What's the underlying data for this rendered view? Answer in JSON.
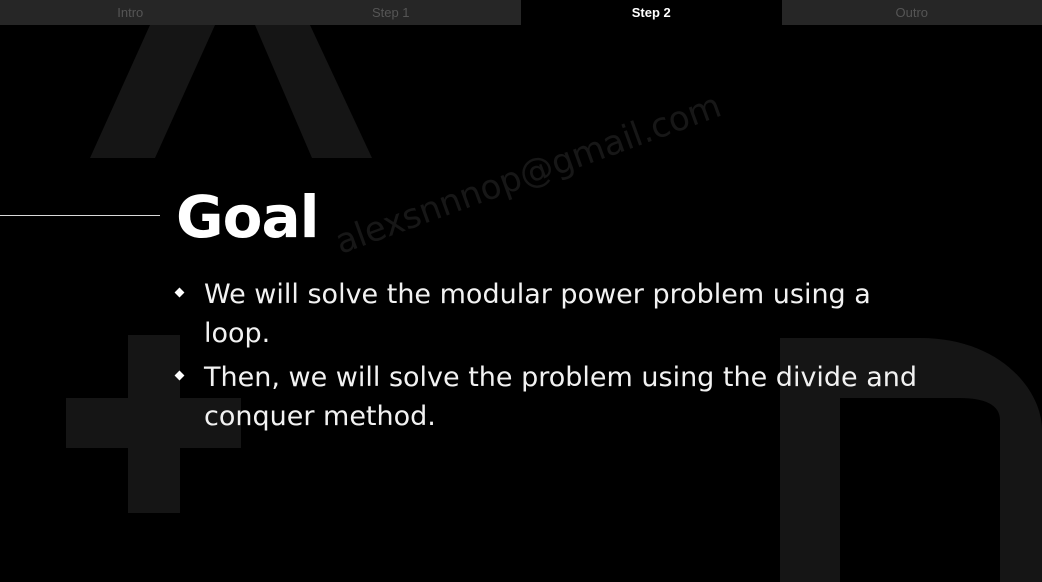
{
  "tabs": [
    {
      "label": "Intro",
      "active": false
    },
    {
      "label": "Step 1",
      "active": false
    },
    {
      "label": "Step 2",
      "active": true
    },
    {
      "label": "Outro",
      "active": false
    }
  ],
  "slide": {
    "title": "Goal",
    "bullets": [
      "We will solve the modular power problem using a loop.",
      "Then, we will solve the problem using the divide and conquer method."
    ],
    "watermark": "alexsnnnop@gmail.com"
  },
  "colors": {
    "background": "#000000",
    "tab_bar": "#262626",
    "tab_inactive_text": "#555555",
    "text": "#ffffff",
    "decor_shapes": "#141414"
  },
  "icons": {
    "bullet": "diamond-bullet-icon"
  }
}
